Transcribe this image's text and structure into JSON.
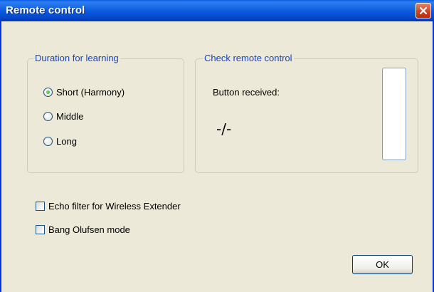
{
  "window": {
    "title": "Remote control"
  },
  "duration_group": {
    "legend": "Duration for learning",
    "options": [
      {
        "label": "Short (Harmony)",
        "checked": true
      },
      {
        "label": "Middle",
        "checked": false
      },
      {
        "label": "Long",
        "checked": false
      }
    ]
  },
  "check_group": {
    "legend": "Check remote control",
    "received_label": "Button received:",
    "received_value": "-/-"
  },
  "options": {
    "echo_filter": {
      "label": "Echo filter for Wireless Extender",
      "checked": false
    },
    "bang_olufsen": {
      "label": "Bang Olufsen mode",
      "checked": false
    }
  },
  "buttons": {
    "ok": "OK"
  },
  "icons": {
    "close": "close-icon"
  },
  "colors": {
    "titlebar": "#0b5ade",
    "legend_text": "#1645bf",
    "window_bg": "#ece9d8",
    "close_button": "#c9401f"
  }
}
